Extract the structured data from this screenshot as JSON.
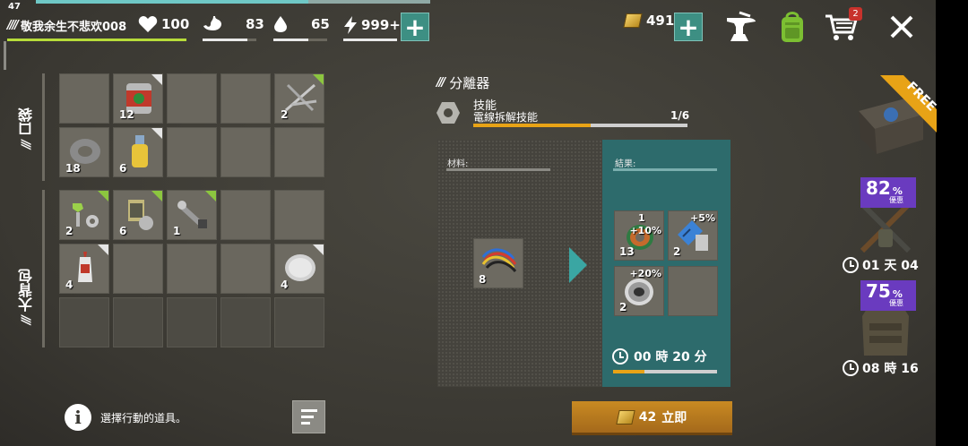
{
  "player": {
    "level": "47",
    "name": "敬我余生不悲欢008"
  },
  "stats": {
    "health": "100",
    "food": "83",
    "water": "65",
    "energy": "999+",
    "gold": "491"
  },
  "stat_bars": {
    "food_fraction": 0.83,
    "water_fraction": 0.65,
    "energy_fraction": 1.0
  },
  "cart_badge": "2",
  "sections": {
    "pocket": "口袋",
    "backpack": "大背包"
  },
  "pocket_items": [
    {
      "count": "",
      "icon": "empty-slot"
    },
    {
      "count": "12",
      "icon": "canned-food-icon"
    },
    {
      "count": "",
      "icon": "empty-slot"
    },
    {
      "count": "",
      "icon": "empty-slot"
    },
    {
      "count": "2",
      "icon": "nails-icon"
    },
    {
      "count": "18",
      "icon": "duct-tape-icon"
    },
    {
      "count": "6",
      "icon": "bottle-icon"
    },
    {
      "count": "",
      "icon": "empty-slot"
    },
    {
      "count": "",
      "icon": "empty-slot"
    },
    {
      "count": "",
      "icon": "empty-slot"
    }
  ],
  "backpack_items": [
    {
      "count": "2",
      "icon": "bolts-icon"
    },
    {
      "count": "6",
      "icon": "parts-icon"
    },
    {
      "count": "1",
      "icon": "wrench-icon"
    },
    {
      "count": "",
      "icon": "empty-slot"
    },
    {
      "count": "",
      "icon": "empty-slot"
    },
    {
      "count": "4",
      "icon": "glue-icon"
    },
    {
      "count": "",
      "icon": "empty-slot"
    },
    {
      "count": "",
      "icon": "empty-slot"
    },
    {
      "count": "",
      "icon": "empty-slot"
    },
    {
      "count": "4",
      "icon": "lens-icon"
    }
  ],
  "hint": "選擇行動的道具。",
  "panel": {
    "title": "分離器",
    "skill_label": "技能",
    "skill_name": "電線拆解技能",
    "skill_progress": "1/6",
    "skill_fraction": 0.55,
    "materials_label": "材料:",
    "results_label": "結果:",
    "material_item": {
      "count": "8",
      "icon": "wires-icon"
    },
    "results": [
      {
        "count": "13",
        "top": "1",
        "bonus": "+10%",
        "icon": "copper-coil-icon"
      },
      {
        "count": "2",
        "top": "",
        "bonus": "+5%",
        "icon": "circuit-icon"
      },
      {
        "count": "2",
        "top": "",
        "bonus": "+20%",
        "icon": "wire-spool-icon"
      },
      {
        "count": "",
        "top": "",
        "bonus": "",
        "icon": "empty-slot"
      }
    ],
    "timer": "00 時 20 分",
    "timer_fraction": 0.3,
    "buy_amount": "42",
    "buy_label": "立即"
  },
  "offers": {
    "free_label": "FREE",
    "offer1": {
      "percent": "82",
      "symbol": "%",
      "sub": "優惠",
      "time": "01 天 04"
    },
    "offer2": {
      "percent": "75",
      "symbol": "%",
      "sub": "優惠",
      "time": "08 時 16"
    }
  },
  "colors": {
    "accent_teal": "#3d8f83",
    "progress_orange": "#e8a316",
    "offer_purple": "#6a3bbf",
    "health_green": "#b7dc3a"
  }
}
